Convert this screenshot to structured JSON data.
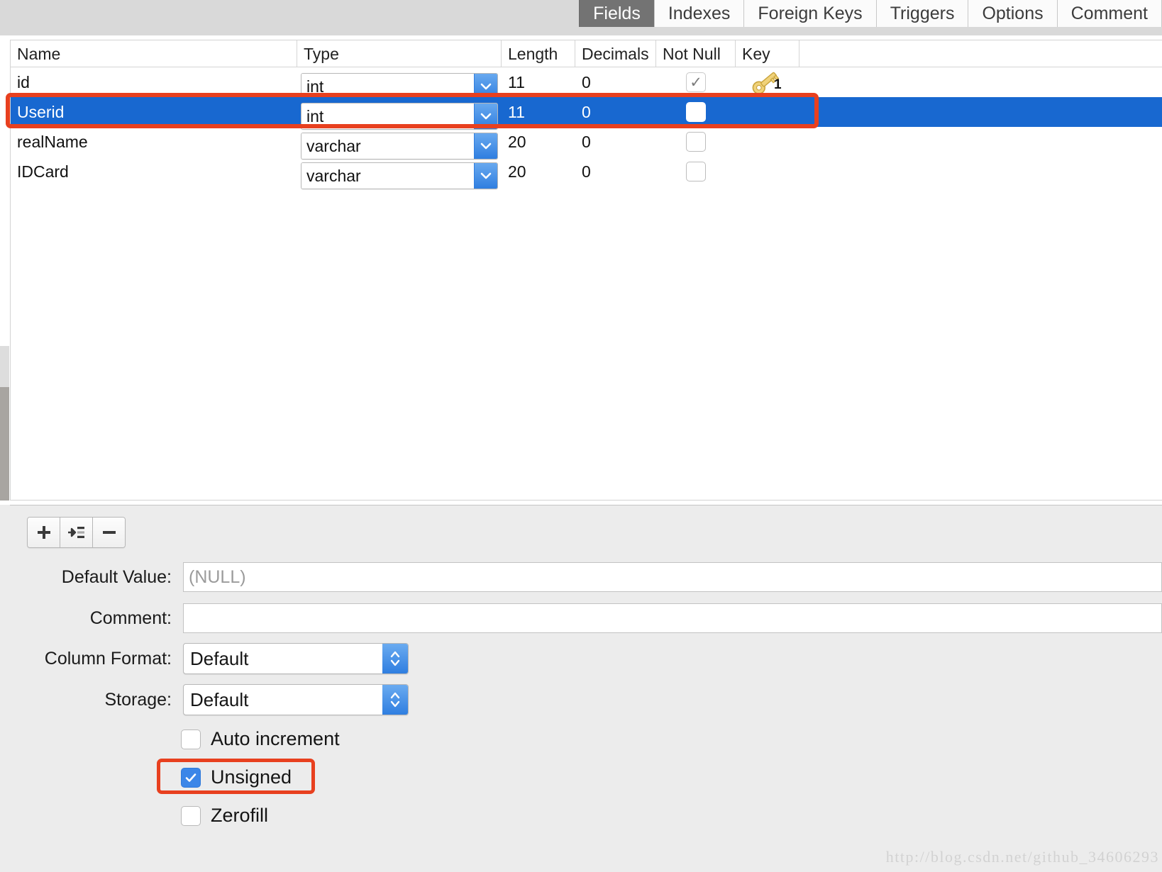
{
  "tabs": [
    {
      "label": "Fields",
      "active": true
    },
    {
      "label": "Indexes",
      "active": false
    },
    {
      "label": "Foreign Keys",
      "active": false
    },
    {
      "label": "Triggers",
      "active": false
    },
    {
      "label": "Options",
      "active": false
    },
    {
      "label": "Comment",
      "active": false
    }
  ],
  "grid": {
    "columns": [
      {
        "label": "Name"
      },
      {
        "label": "Type"
      },
      {
        "label": "Length"
      },
      {
        "label": "Decimals"
      },
      {
        "label": "Not Null"
      },
      {
        "label": "Key"
      }
    ],
    "rows": [
      {
        "name": "id",
        "type": "int",
        "length": "11",
        "decimals": "0",
        "not_null": true,
        "not_null_disabled": true,
        "key": "primary-key-icon",
        "key_number": "1",
        "selected": false
      },
      {
        "name": "Userid",
        "type": "int",
        "length": "11",
        "decimals": "0",
        "not_null": false,
        "not_null_disabled": false,
        "key": "",
        "key_number": "",
        "selected": true
      },
      {
        "name": "realName",
        "type": "varchar",
        "length": "20",
        "decimals": "0",
        "not_null": false,
        "not_null_disabled": false,
        "key": "",
        "key_number": "",
        "selected": false
      },
      {
        "name": "IDCard",
        "type": "varchar",
        "length": "20",
        "decimals": "0",
        "not_null": false,
        "not_null_disabled": false,
        "key": "",
        "key_number": "",
        "selected": false
      }
    ]
  },
  "toolbar": {
    "add_field_label": "+",
    "insert_field_label": "insert-field-icon",
    "delete_field_label": "−"
  },
  "form": {
    "default_value": {
      "label": "Default Value:",
      "value": "",
      "placeholder": "(NULL)"
    },
    "comment": {
      "label": "Comment:",
      "value": "",
      "placeholder": ""
    },
    "column_format": {
      "label": "Column Format:",
      "value": "Default"
    },
    "storage": {
      "label": "Storage:",
      "value": "Default"
    },
    "auto_increment": {
      "label": "Auto increment",
      "checked": false
    },
    "unsigned": {
      "label": "Unsigned",
      "checked": true
    },
    "zerofill": {
      "label": "Zerofill",
      "checked": false
    }
  },
  "annotations": {
    "highlight_color": "#e8401f",
    "selected_row_color": "#1868d0",
    "accent_color": "#2f7ee0"
  },
  "watermark": "http://blog.csdn.net/github_34606293"
}
